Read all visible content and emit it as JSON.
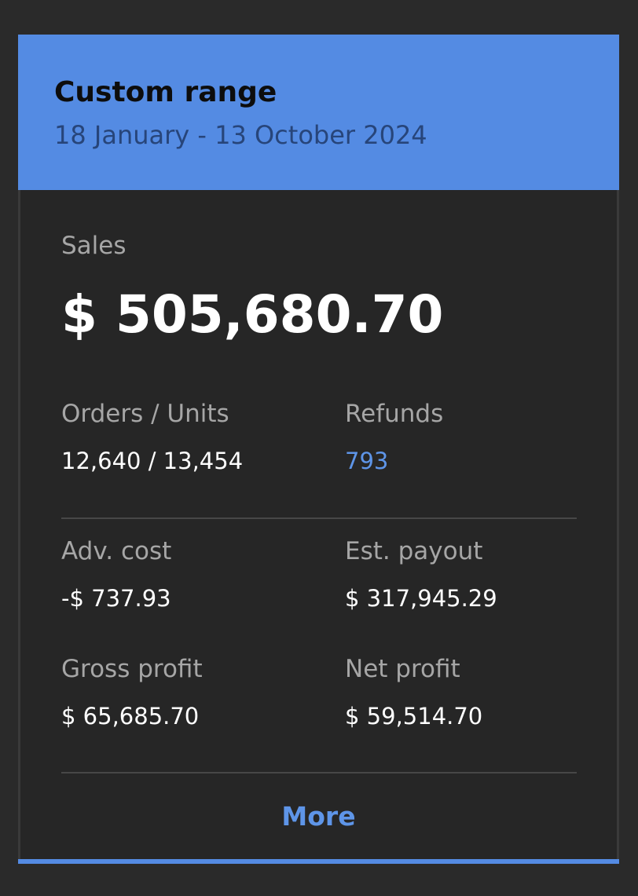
{
  "header": {
    "title": "Custom range",
    "date_range": "18 January - 13 October 2024"
  },
  "sales": {
    "label": "Sales",
    "value": "$ 505,680.70"
  },
  "metrics": {
    "orders_units": {
      "label": "Orders / Units",
      "value": "12,640 / 13,454"
    },
    "refunds": {
      "label": "Refunds",
      "value": "793"
    },
    "adv_cost": {
      "label": "Adv. cost",
      "value": "-$ 737.93"
    },
    "est_payout": {
      "label": "Est. payout",
      "value": "$ 317,945.29"
    },
    "gross_profit": {
      "label": "Gross profit",
      "value": "$ 65,685.70"
    },
    "net_profit": {
      "label": "Net profit",
      "value": "$ 59,514.70"
    }
  },
  "actions": {
    "more_label": "More"
  },
  "colors": {
    "accent": "#548be3",
    "link": "#5e95e8",
    "card_background": "#262626",
    "page_background": "#2a2a2a"
  }
}
